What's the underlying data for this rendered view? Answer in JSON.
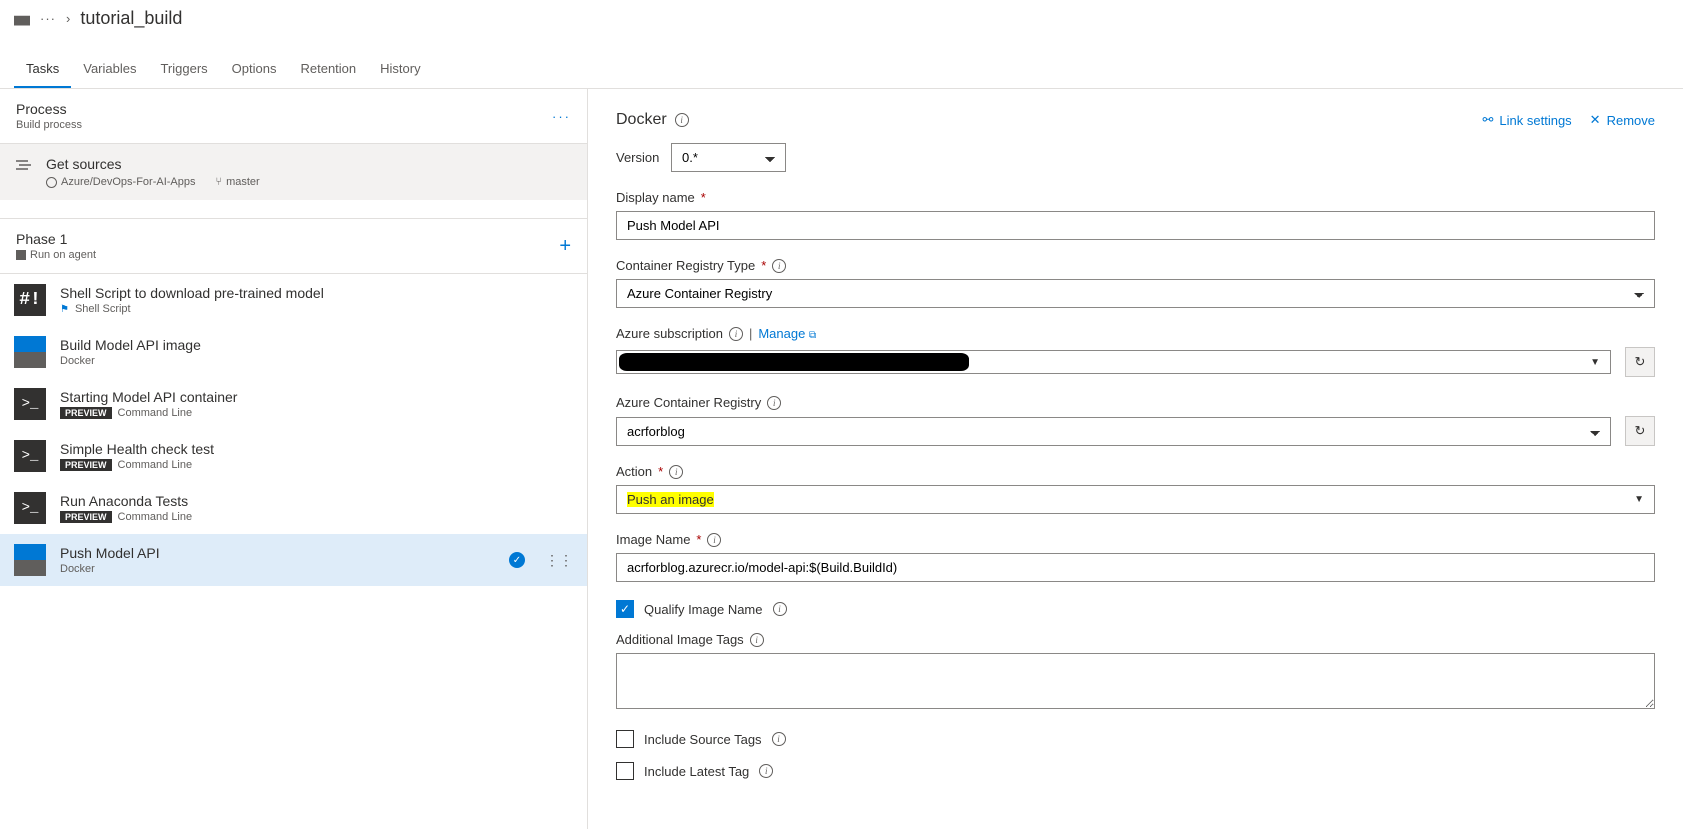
{
  "breadcrumb": {
    "dots": "···",
    "title": "tutorial_build"
  },
  "tabs": [
    "Tasks",
    "Variables",
    "Triggers",
    "Options",
    "Retention",
    "History"
  ],
  "active_tab": "Tasks",
  "process": {
    "title": "Process",
    "subtitle": "Build process"
  },
  "get_sources": {
    "title": "Get sources",
    "repo": "Azure/DevOps-For-AI-Apps",
    "branch": "master"
  },
  "phase": {
    "title": "Phase 1",
    "subtitle": "Run on agent"
  },
  "tasks": [
    {
      "title": "Shell Script to download pre-trained model",
      "subtitle": "Shell Script",
      "icon": "shell",
      "flag": true
    },
    {
      "title": "Build Model API image",
      "subtitle": "Docker",
      "icon": "docker"
    },
    {
      "title": "Starting Model API container",
      "subtitle": "Command Line",
      "icon": "cmd",
      "preview": true
    },
    {
      "title": "Simple Health check test",
      "subtitle": "Command Line",
      "icon": "cmd",
      "preview": true
    },
    {
      "title": "Run Anaconda Tests",
      "subtitle": "Command Line",
      "icon": "cmd",
      "preview": true
    },
    {
      "title": "Push Model API",
      "subtitle": "Docker",
      "icon": "docker",
      "selected": true,
      "checked": true
    }
  ],
  "right": {
    "title": "Docker",
    "link_settings": "Link settings",
    "remove": "Remove",
    "version": {
      "label": "Version",
      "value": "0.*"
    },
    "display_name": {
      "label": "Display name",
      "value": "Push Model API"
    },
    "registry_type": {
      "label": "Container Registry Type",
      "value": "Azure Container Registry"
    },
    "subscription": {
      "label": "Azure subscription",
      "manage": "Manage"
    },
    "acr": {
      "label": "Azure Container Registry",
      "value": "acrforblog"
    },
    "action": {
      "label": "Action",
      "value": "Push an image"
    },
    "image_name": {
      "label": "Image Name",
      "value": "acrforblog.azurecr.io/model-api:$(Build.BuildId)"
    },
    "qualify": {
      "label": "Qualify Image Name",
      "checked": true
    },
    "additional_tags": {
      "label": "Additional Image Tags",
      "value": ""
    },
    "include_source": {
      "label": "Include Source Tags",
      "checked": false
    },
    "include_latest": {
      "label": "Include Latest Tag",
      "checked": false
    },
    "preview_badge": "PREVIEW"
  }
}
